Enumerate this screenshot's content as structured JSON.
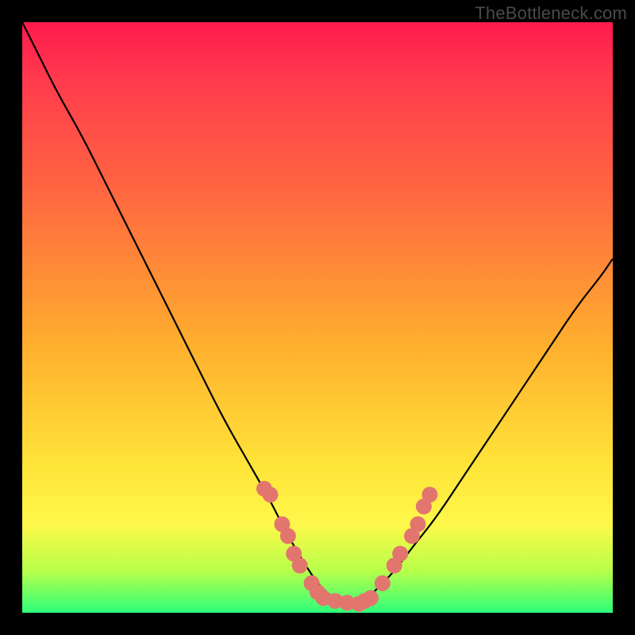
{
  "watermark": "TheBottleneck.com",
  "colors": {
    "curve_stroke": "#000000",
    "marker_fill": "#e2766f",
    "gradient_top": "#ff1a4d",
    "gradient_mid": "#ffe439",
    "gradient_bottom": "#2dff7a",
    "frame": "#000000"
  },
  "chart_data": {
    "type": "line",
    "title": "",
    "xlabel": "",
    "ylabel": "",
    "xlim": [
      0,
      100
    ],
    "ylim": [
      0,
      100
    ],
    "x": [
      0,
      3,
      6,
      10,
      14,
      18,
      22,
      26,
      30,
      34,
      38,
      42,
      45,
      48,
      50,
      52,
      54,
      56,
      58,
      60,
      63,
      66,
      70,
      74,
      78,
      82,
      86,
      90,
      94,
      98,
      100
    ],
    "series": [
      {
        "name": "bottleneck-curve",
        "values": [
          100,
          94,
          88,
          81,
          73,
          65,
          57,
          49,
          41,
          33,
          26,
          19,
          13,
          8,
          5,
          3,
          2,
          1.5,
          2,
          4,
          7,
          11,
          16,
          22,
          28,
          34,
          40,
          46,
          52,
          57,
          60
        ]
      }
    ],
    "markers": {
      "name": "highlighted-points",
      "color": "#e2766f",
      "radius_px": 10,
      "points": [
        {
          "x": 41,
          "y": 21
        },
        {
          "x": 42,
          "y": 20
        },
        {
          "x": 44,
          "y": 15
        },
        {
          "x": 45,
          "y": 13
        },
        {
          "x": 46,
          "y": 10
        },
        {
          "x": 47,
          "y": 8
        },
        {
          "x": 49,
          "y": 5
        },
        {
          "x": 50,
          "y": 3.5
        },
        {
          "x": 51,
          "y": 2.5
        },
        {
          "x": 53,
          "y": 2
        },
        {
          "x": 55,
          "y": 1.7
        },
        {
          "x": 57,
          "y": 1.5
        },
        {
          "x": 58,
          "y": 2
        },
        {
          "x": 59,
          "y": 2.5
        },
        {
          "x": 61,
          "y": 5
        },
        {
          "x": 63,
          "y": 8
        },
        {
          "x": 64,
          "y": 10
        },
        {
          "x": 66,
          "y": 13
        },
        {
          "x": 67,
          "y": 15
        },
        {
          "x": 68,
          "y": 18
        },
        {
          "x": 69,
          "y": 20
        }
      ]
    }
  }
}
